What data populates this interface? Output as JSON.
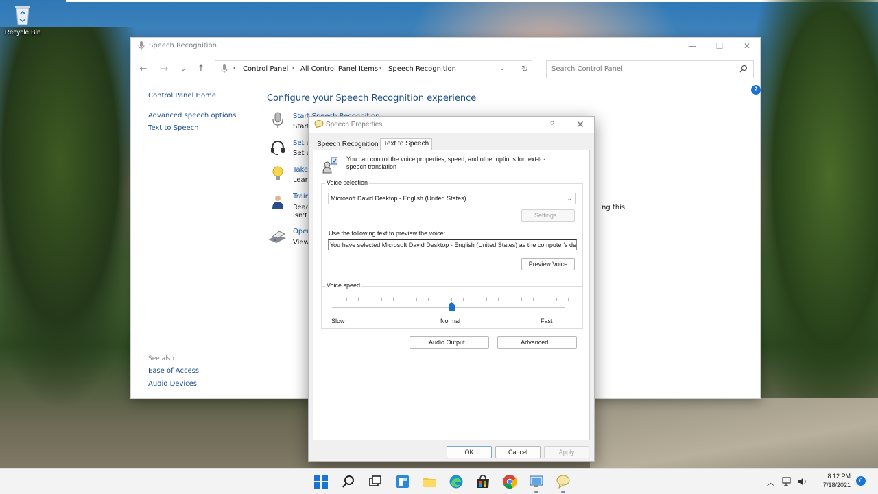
{
  "desktop": {
    "recycle_bin": "Recycle Bin"
  },
  "control_panel": {
    "title": "Speech Recognition",
    "breadcrumbs": [
      "Control Panel",
      "All Control Panel Items",
      "Speech Recognition"
    ],
    "search_placeholder": "Search Control Panel",
    "left_links": [
      "Control Panel Home",
      "Advanced speech options",
      "Text to Speech"
    ],
    "see_also_title": "See also",
    "see_also_links": [
      "Ease of Access",
      "Audio Devices"
    ],
    "heading": "Configure your Speech Recognition experience",
    "items": [
      {
        "link": "Start Speech Recognition",
        "text": "Start"
      },
      {
        "link": "Set u",
        "text": "Set u"
      },
      {
        "link": "Take",
        "text": "Learn"
      },
      {
        "link": "Train",
        "text": "Read",
        "text2": "isn't"
      },
      {
        "link": "Open",
        "text": "View"
      }
    ],
    "tail_text": "ng this",
    "help": "?"
  },
  "dialog": {
    "title": "Speech Properties",
    "help": "?",
    "close": "✕",
    "tabs": [
      "Speech Recognition",
      "Text to Speech"
    ],
    "active_tab": "Text to Speech",
    "intro": "You can control the voice properties, speed, and other options for text-to-speech translation",
    "voice_selection_label": "Voice selection",
    "voice_selected": "Microsoft David Desktop - English (United States)",
    "settings_button": "Settings...",
    "preview_label": "Use the following text to preview the voice:",
    "preview_text": "You have selected Microsoft David Desktop - English (United States) as the computer's default voice.",
    "preview_button": "Preview Voice",
    "voice_speed_label": "Voice speed",
    "speed_labels": {
      "slow": "Slow",
      "normal": "Normal",
      "fast": "Fast"
    },
    "speed_value": "Normal",
    "audio_output_button": "Audio Output...",
    "advanced_button": "Advanced...",
    "ok": "OK",
    "cancel": "Cancel",
    "apply": "Apply"
  },
  "taskbar": {
    "time": "8:12 PM",
    "date": "7/18/2021",
    "notifications": "6"
  },
  "colors": {
    "accent": "#1a73d2",
    "link": "#1b4e8d",
    "heading": "#1d4e89"
  }
}
